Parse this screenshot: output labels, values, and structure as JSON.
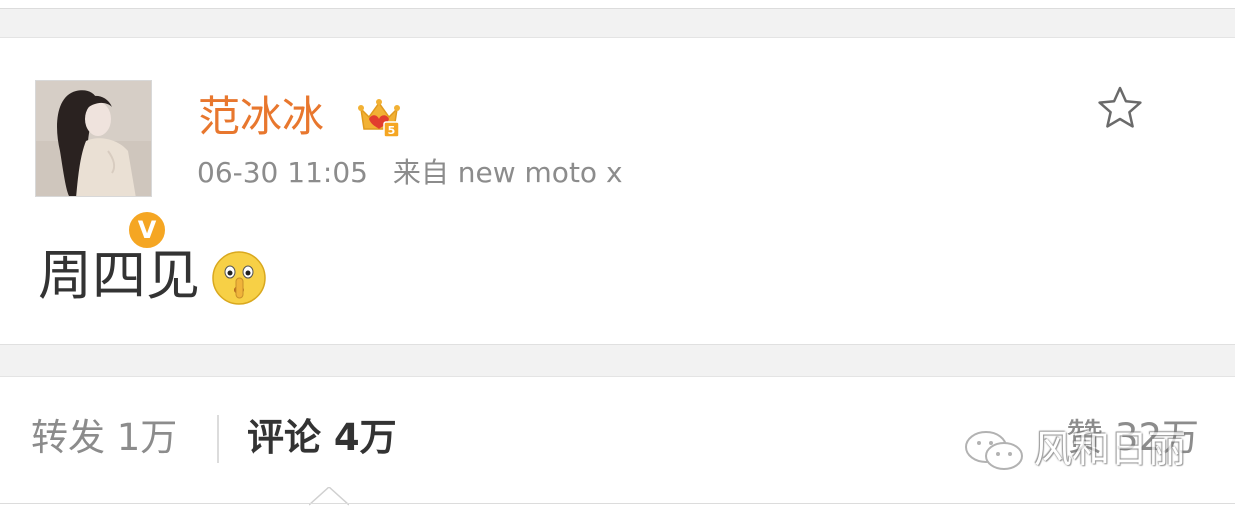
{
  "post": {
    "username": "范冰冰",
    "timestamp": "06-30 11:05",
    "source": "来自 new moto x",
    "text": "周四见",
    "verified_badge": "V"
  },
  "icons": {
    "crown": "crown-icon",
    "star": "star-icon",
    "emoji": "shush-emoji-icon"
  },
  "actions": {
    "repost_label": "转发 1万",
    "comment_label": "评论 4万",
    "like_label": "赞 32万"
  },
  "watermark": {
    "text": "风和日丽"
  },
  "colors": {
    "username": "#e8772e",
    "meta": "#8c8c8c",
    "badge": "#f5a623",
    "text": "#333333"
  }
}
